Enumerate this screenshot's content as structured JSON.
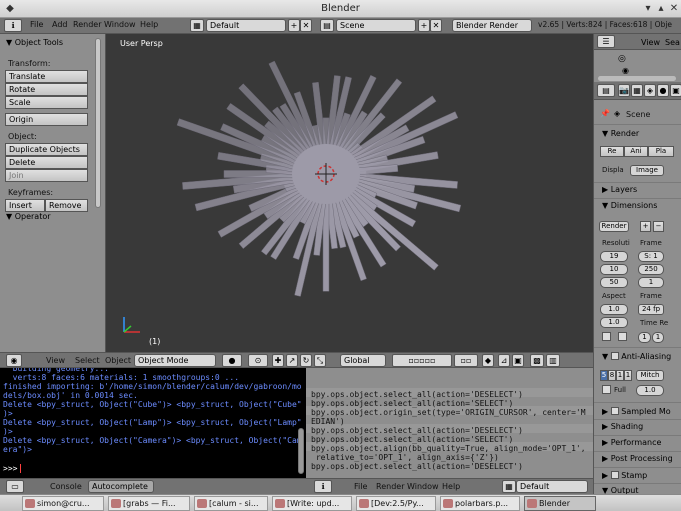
{
  "window": {
    "title": "Blender"
  },
  "infobar": {
    "menus": [
      "File",
      "Add",
      "Render",
      "Window",
      "Help"
    ],
    "screen_layout": "Default",
    "scene": "Scene",
    "engine": "Blender Render",
    "stats": "v2.65 | Verts:824 | Faces:618 | Obje"
  },
  "toolshelf": {
    "panel_object_tools": "Object Tools",
    "transform_label": "Transform:",
    "buttons_transform": [
      "Translate",
      "Rotate",
      "Scale"
    ],
    "origin": "Origin",
    "object_label": "Object:",
    "buttons_object": [
      "Duplicate Objects",
      "Delete",
      "Join"
    ],
    "keyframes_label": "Keyframes:",
    "insert": "Insert",
    "remove": "Remove",
    "panel_operator": "Operator"
  },
  "viewport": {
    "view_label": "User Persp",
    "object_label": "(1)"
  },
  "viewport_header": {
    "menus": [
      "View",
      "Select",
      "Object"
    ],
    "mode": "Object Mode",
    "orientation": "Global"
  },
  "console": {
    "lines": [
      {
        "text": "  building geometry...",
        "color": "blue"
      },
      {
        "text": "  verts:8 faces:6 materials: 1 smoothgroups:0 ...",
        "color": "blue"
      },
      {
        "text": "finished importing: b'/home/simon/blender/calum/dev/gabroon/mo",
        "color": "blue"
      },
      {
        "text": "dels/box.obj' in 0.0014 sec.",
        "color": "blue"
      },
      {
        "text": "Delete <bpy_struct, Object(\"Cube\")> <bpy_struct, Object(\"Cube\"",
        "color": "blue"
      },
      {
        "text": ")>",
        "color": "blue"
      },
      {
        "text": "Delete <bpy_struct, Object(\"Lamp\")> <bpy_struct, Object(\"Lamp\"",
        "color": "blue"
      },
      {
        "text": ")>",
        "color": "blue"
      },
      {
        "text": "Delete <bpy_struct, Object(\"Camera\")> <bpy_struct, Object(\"Cam",
        "color": "blue"
      },
      {
        "text": "era\")>",
        "color": "blue"
      }
    ],
    "prompt": ">>> "
  },
  "console_footer": {
    "console": "Console",
    "autocomplete": "Autocomplete"
  },
  "report": {
    "lines": [
      "bpy.ops.object.select_all(action='DESELECT')",
      "bpy.ops.object.select_all(action='SELECT')",
      "bpy.ops.object.origin_set(type='ORIGIN_CURSOR', center='M",
      "EDIAN')",
      "bpy.ops.object.select_all(action='DESELECT')",
      "bpy.ops.object.select_all(action='SELECT')",
      "bpy.ops.object.align(bb_quality=True, align_mode='OPT_1',",
      " relative_to='OPT_1', align_axis={'Z'})",
      "bpy.ops.object.select_all(action='DESELECT')"
    ]
  },
  "report_footer": {
    "menus": [
      "File",
      "Render",
      "Window",
      "Help"
    ],
    "layout": "Default"
  },
  "outliner": {
    "menus": [
      "View",
      "Sea"
    ]
  },
  "properties": {
    "scene_label": "Scene",
    "panel_render": "Render",
    "render_btns": [
      "Re",
      "Ani",
      "Pla"
    ],
    "display_label": "Displa",
    "display_value": "Image",
    "panel_layers": "Layers",
    "panel_dimensions": "Dimensions",
    "preset": "Render",
    "resolution_label": "Resoluti",
    "frame_label": "Frame",
    "res_x": "19",
    "res_y": "10",
    "res_pct": "50",
    "frame_start": "S: 1",
    "frame_end": "250",
    "frame_step": "1",
    "aspect_label": "Aspect",
    "frame_rate_label": "Frame",
    "aspect_x": "1.0",
    "aspect_y": "1.0",
    "fps": "24 fp",
    "time_remap_label": "Time Re",
    "time_old": "1",
    "time_new": "1",
    "panel_aa": "Anti-Aliasing",
    "aa_samples": [
      "5",
      "8",
      "1",
      "1"
    ],
    "aa_filter": "Mitch",
    "full_label": "Full",
    "aa_size": "1.0",
    "panel_sampled_motion": "Sampled Mo",
    "panel_shading": "Shading",
    "panel_performance": "Performance",
    "panel_post_processing": "Post Processing",
    "panel_stamp": "Stamp",
    "panel_output": "Output"
  },
  "taskbar": {
    "tasks": [
      "simon@cru...",
      "[grabs — Fi...",
      "[calum - si...",
      "[Write: upd...",
      "[Dev:2.5/Py...",
      "polarbars.p...",
      "Blender"
    ]
  },
  "colors": {
    "viewport_bg": "#393939",
    "mesh_fill": "#9d9aa8",
    "console_text": "#6c8cff",
    "panel_bg": "#8e8e8e",
    "header_bg": "#727272"
  }
}
